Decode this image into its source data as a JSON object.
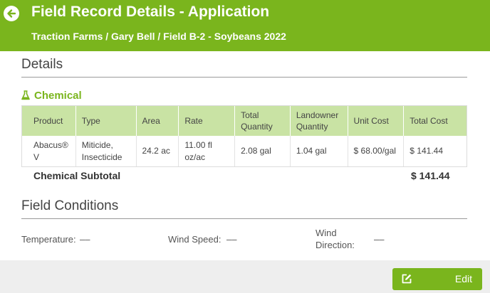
{
  "header": {
    "title": "Field Record Details - Application",
    "breadcrumb": "Traction Farms / Gary Bell / Field B-2 - Soybeans 2022"
  },
  "details": {
    "title": "Details"
  },
  "chemical": {
    "heading": "Chemical",
    "columns": [
      "Product",
      "Type",
      "Area",
      "Rate",
      "Total\nQuantity",
      "Landowner\nQuantity",
      "Unit Cost",
      "Total Cost"
    ],
    "rows": [
      [
        "Abacus® V",
        "Miticide,\nInsecticide",
        "24.2 ac",
        "11.00 fl oz/ac",
        "2.08 gal",
        "1.04 gal",
        "$ 68.00/gal",
        "$ 141.44"
      ]
    ],
    "subtotal_label": "Chemical Subtotal",
    "subtotal_value": "$ 141.44"
  },
  "field_conditions": {
    "title": "Field Conditions",
    "temperature_label": "Temperature:",
    "temperature_value": "––",
    "wind_speed_label": "Wind Speed:",
    "wind_speed_value": "––",
    "wind_direction_label": "Wind\nDirection:",
    "wind_direction_value": "––"
  },
  "footer": {
    "edit_label": "Edit"
  },
  "colors": {
    "brand_green": "#7ab51d",
    "table_header": "#c9e3a4"
  },
  "icons": {
    "back": "back-arrow-icon",
    "chemical": "flask-icon",
    "edit": "edit-icon"
  }
}
